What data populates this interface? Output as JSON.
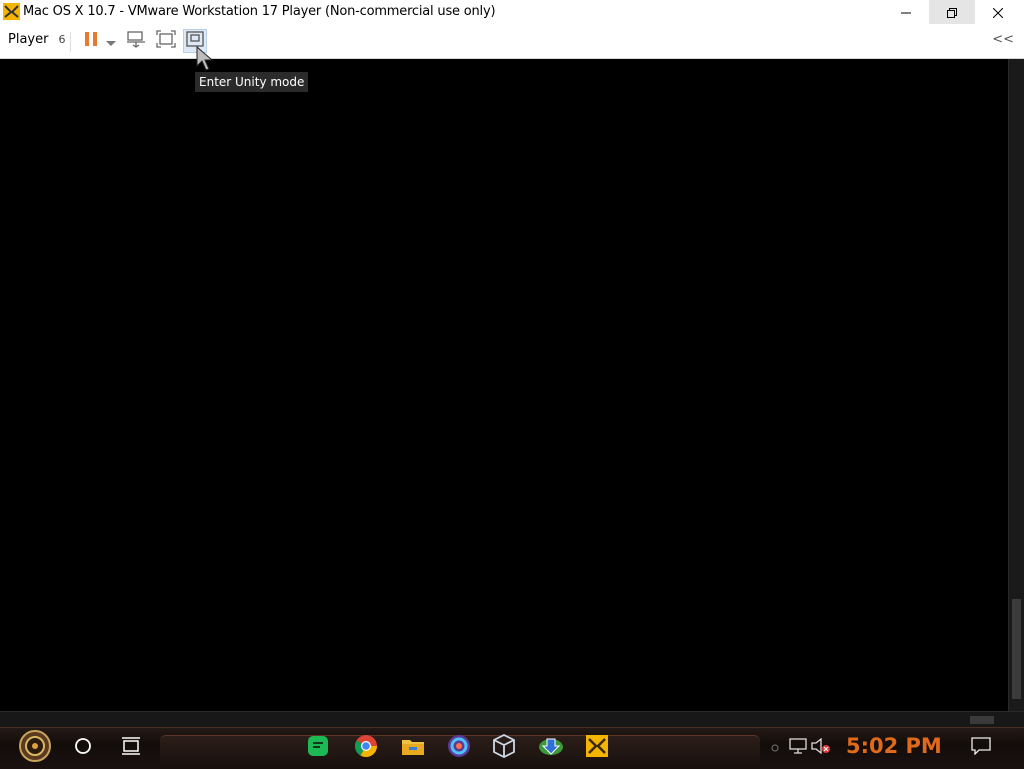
{
  "window": {
    "title": "Mac OS X 10.7 - VMware Workstation 17 Player (Non-commercial use only)",
    "icon": "vmware-icon",
    "controls": [
      "minimize-icon",
      "restore-icon",
      "close-icon"
    ]
  },
  "toolbar": {
    "player_label": "Player",
    "player_dropdown_glyph": "6",
    "icons": [
      "pause-icon",
      "dropdown-arrow-icon",
      "send-ctrl-alt-del-icon",
      "fullscreen-icon",
      "unity-mode-icon"
    ],
    "collapse_glyph": "<<",
    "tooltip": "Enter Unity mode"
  },
  "taskbar": {
    "clock": "5:02 PM",
    "apps": [
      "start-orb-icon",
      "cortana-circle-icon",
      "task-view-icon",
      "green-chat-app-icon",
      "chrome-icon",
      "file-explorer-icon",
      "browser-icon",
      "virtualbox-icon",
      "download-manager-icon",
      "vmware-icon"
    ],
    "tray": [
      "network-icon",
      "volume-muted-icon",
      "notifications-icon"
    ]
  },
  "colors": {
    "accent_orange": "#e06a1b",
    "taskbar_bg": "#1b1210"
  }
}
